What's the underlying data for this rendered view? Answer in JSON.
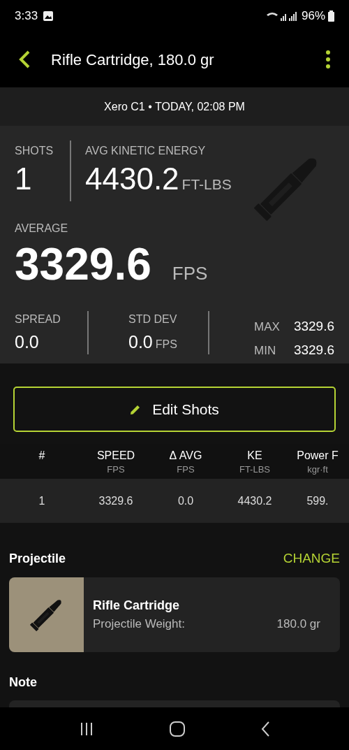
{
  "status_bar": {
    "time": "3:33",
    "battery": "96%"
  },
  "app_bar": {
    "title": "Rifle Cartridge, 180.0 gr"
  },
  "session": {
    "text": "Xero C1 • TODAY, 02:08 PM"
  },
  "summary": {
    "shots_label": "SHOTS",
    "shots": "1",
    "ke_label": "AVG KINETIC ENERGY",
    "ke": "4430.2",
    "ke_unit": "FT-LBS",
    "average_label": "AVERAGE",
    "average": "3329.6",
    "average_unit": "FPS",
    "spread_label": "SPREAD",
    "spread": "0.0",
    "std_label": "STD DEV",
    "std": "0.0",
    "std_unit": "FPS",
    "max_label": "MAX",
    "max": "3329.6",
    "min_label": "MIN",
    "min": "3329.6"
  },
  "edit_button": {
    "label": "Edit Shots"
  },
  "table": {
    "columns": [
      {
        "title": "#"
      },
      {
        "title": "SPEED",
        "unit": "FPS"
      },
      {
        "title": "Δ AVG",
        "unit": "FPS"
      },
      {
        "title": "KE",
        "unit": "FT-LBS"
      },
      {
        "title": "Power F",
        "unit": "kgr·ft"
      }
    ],
    "rows": [
      [
        "1",
        "3329.6",
        "0.0",
        "4430.2",
        "599."
      ]
    ]
  },
  "projectile": {
    "heading": "Projectile",
    "action": "CHANGE",
    "name": "Rifle Cartridge",
    "weight_label": "Projectile Weight:",
    "weight": "180.0 gr"
  },
  "note": {
    "heading": "Note"
  }
}
